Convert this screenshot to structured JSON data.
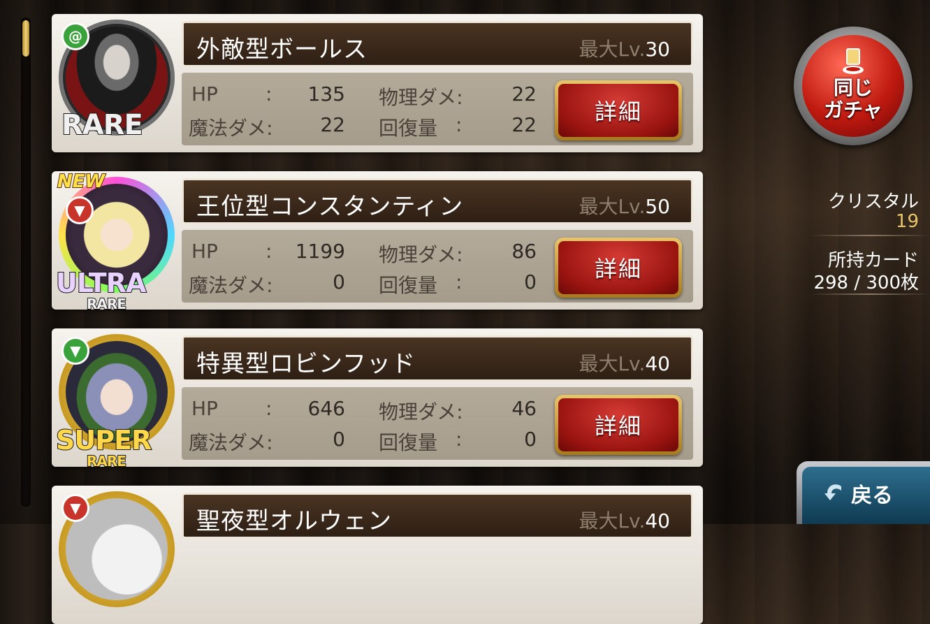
{
  "cards": [
    {
      "name": "外敵型ボールス",
      "lv_label": "最大Lv.",
      "lv_value": "30",
      "rarity": "RARE",
      "rarity_sub": "",
      "new": "",
      "attribute": "green",
      "stats": {
        "hp_label": "HP",
        "hp": "135",
        "phys_label": "物理ダメ:",
        "phys": "22",
        "mag_label": "魔法ダメ:",
        "mag": "22",
        "heal_label": "回復量",
        "heal": "22"
      },
      "button": "詳細"
    },
    {
      "name": "王位型コンスタンティン",
      "lv_label": "最大Lv.",
      "lv_value": "50",
      "rarity": "ULTRA",
      "rarity_sub": "RARE",
      "new": "NEW",
      "attribute": "red",
      "stats": {
        "hp_label": "HP",
        "hp": "1199",
        "phys_label": "物理ダメ:",
        "phys": "86",
        "mag_label": "魔法ダメ:",
        "mag": "0",
        "heal_label": "回復量",
        "heal": "0"
      },
      "button": "詳細"
    },
    {
      "name": "特異型ロビンフッド",
      "lv_label": "最大Lv.",
      "lv_value": "40",
      "rarity": "SUPER",
      "rarity_sub": "RARE",
      "new": "",
      "attribute": "green",
      "stats": {
        "hp_label": "HP",
        "hp": "646",
        "phys_label": "物理ダメ:",
        "phys": "46",
        "mag_label": "魔法ダメ:",
        "mag": "0",
        "heal_label": "回復量",
        "heal": "0"
      },
      "button": "詳細"
    },
    {
      "name": "聖夜型オルウェン",
      "lv_label": "最大Lv.",
      "lv_value": "40",
      "attribute": "red"
    }
  ],
  "colon": ":",
  "gacha_button": {
    "line1": "同じ",
    "line2": "ガチャ"
  },
  "crystal": {
    "label": "クリスタル",
    "value": "19"
  },
  "cards_owned": {
    "label": "所持カード",
    "value": "298 / 300枚"
  },
  "back_button": "戻る",
  "colors": {
    "gold": "#e8c46a",
    "red": "#c01a10",
    "green_attr": "#3aa23a",
    "red_attr": "#c8342a"
  }
}
